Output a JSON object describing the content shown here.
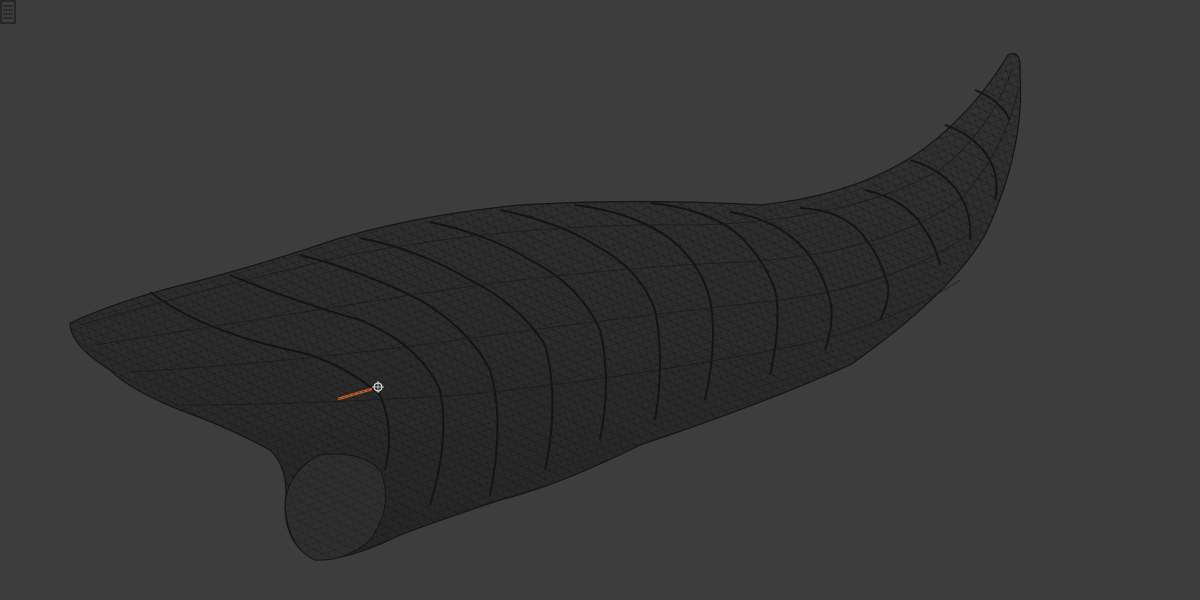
{
  "viewport": {
    "background_color": "#3d3d3d",
    "mesh_fill_color": "#2e2e2e",
    "wire_color": "#141414",
    "gizmo_color": "#c8602a"
  },
  "icons": {
    "camera": "camera-icon",
    "origin": "origin-pivot-icon",
    "transform_gizmo": "transform-gizmo-icon"
  }
}
